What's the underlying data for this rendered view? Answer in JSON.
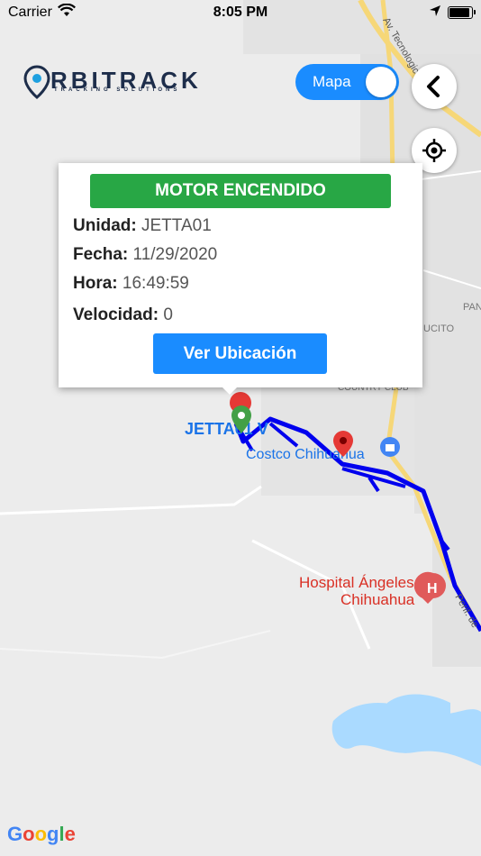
{
  "status_bar": {
    "carrier": "Carrier",
    "time": "8:05 PM",
    "battery_level": 1.0
  },
  "logo": {
    "name_lead": "O",
    "name_rest": "RBITRACK",
    "tagline": "TRACKING SOLUTIONS"
  },
  "map_toggle": {
    "label": "Mapa",
    "on": true
  },
  "map_labels": {
    "avenue": "Av. Tecnologico",
    "pan": "PAN",
    "ucito": "UCITO",
    "country_club": "COUNTRY CLUB",
    "vehicle": "JETTA01 V",
    "costco": "Costco Chihuahua",
    "hospital_line1": "Hospital Ángeles",
    "hospital_line2": "Chihuahua",
    "perif": "Perif. de",
    "google_letters": [
      "G",
      "o",
      "o",
      "g",
      "l",
      "e"
    ]
  },
  "info_card": {
    "status": "MOTOR ENCENDIDO",
    "unidad_label": "Unidad:",
    "unidad_value": "JETTA01",
    "fecha_label": "Fecha:",
    "fecha_value": "11/29/2020",
    "hora_label": "Hora:",
    "hora_value": "16:49:59",
    "velocidad_label": "Velocidad:",
    "velocidad_value": "0",
    "button": "Ver Ubicación"
  },
  "colors": {
    "route": "#0000ee",
    "status_green": "#28a745",
    "accent_blue": "#1a8cff",
    "pin_red": "#e53935",
    "pin_green": "#43a047",
    "water": "#aadaff",
    "road_yellow": "#f6d778"
  },
  "icons": [
    "wifi-icon",
    "location-arrow-icon",
    "battery-icon",
    "back-chevron-icon",
    "locate-icon",
    "map-pin-icon",
    "hospital-icon",
    "shopping-icon"
  ]
}
